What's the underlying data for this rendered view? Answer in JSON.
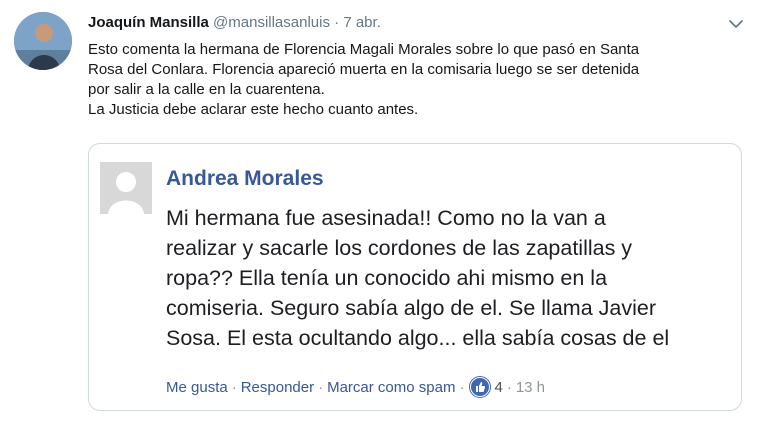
{
  "tweet": {
    "author_name": "Joaquín Mansilla",
    "handle": "@mansillasanluis",
    "separator": "·",
    "date": "7 abr.",
    "avatar_icon": "user-avatar-photo",
    "menu_icon": "chevron-down-icon",
    "text_lines": [
      "Esto comenta la hermana de Florencia Magali Morales sobre lo que pasó en Santa",
      "Rosa del Conlara. Florencia apareció muerta en la comisaria luego se ser detenida",
      "por salir a la calle en la cuarentena.",
      "La Justicia debe aclarar este hecho cuanto antes."
    ]
  },
  "embedded_comment": {
    "author": "Andrea Morales",
    "avatar_icon": "default-profile-silhouette",
    "text_lines": [
      "Mi hermana fue asesinada!! Como no la van a",
      "realizar y sacarle los cordones de las zapatillas y",
      "ropa?? Ella tenía un conocido ahi mismo en la",
      "comiseria. Seguro sabía algo de el. Se llama Javier",
      "Sosa. El esta ocultando algo... ella sabía cosas de el"
    ],
    "actions": {
      "like": "Me gusta",
      "reply": "Responder",
      "spam": "Marcar como spam",
      "separator": "·",
      "reaction_icon": "thumbs-up-icon",
      "reaction_count": "4",
      "time": "13 h"
    },
    "colors": {
      "author": "#385898",
      "link": "#385898",
      "like_badge": "#4267b2"
    }
  }
}
